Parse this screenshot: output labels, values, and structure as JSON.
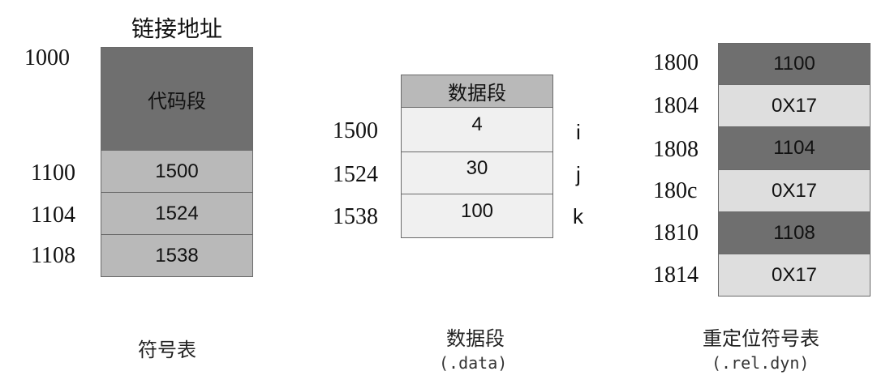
{
  "title": "链接地址",
  "colors": {
    "dark": "#6f6f6f",
    "medium": "#b9b9b9",
    "light": "#dedede",
    "lighter": "#f0f0f0"
  },
  "symtab": {
    "code_label": "代码段",
    "addresses": [
      "1000",
      "1100",
      "1104",
      "1108"
    ],
    "values": [
      "1500",
      "1524",
      "1538"
    ],
    "caption": "符号表"
  },
  "data": {
    "header": "数据段",
    "addresses": [
      "1500",
      "1524",
      "1538"
    ],
    "values": [
      "4",
      "30",
      "100"
    ],
    "vars": [
      "i",
      "j",
      "k"
    ],
    "caption": "数据段",
    "subcaption": "(.data)"
  },
  "reldyn": {
    "addresses": [
      "1800",
      "1804",
      "1808",
      "180c",
      "1810",
      "1814"
    ],
    "values": [
      "1100",
      "0X17",
      "1104",
      "0X17",
      "1108",
      "0X17"
    ],
    "caption": "重定位符号表",
    "subcaption": "(.rel.dyn)"
  }
}
